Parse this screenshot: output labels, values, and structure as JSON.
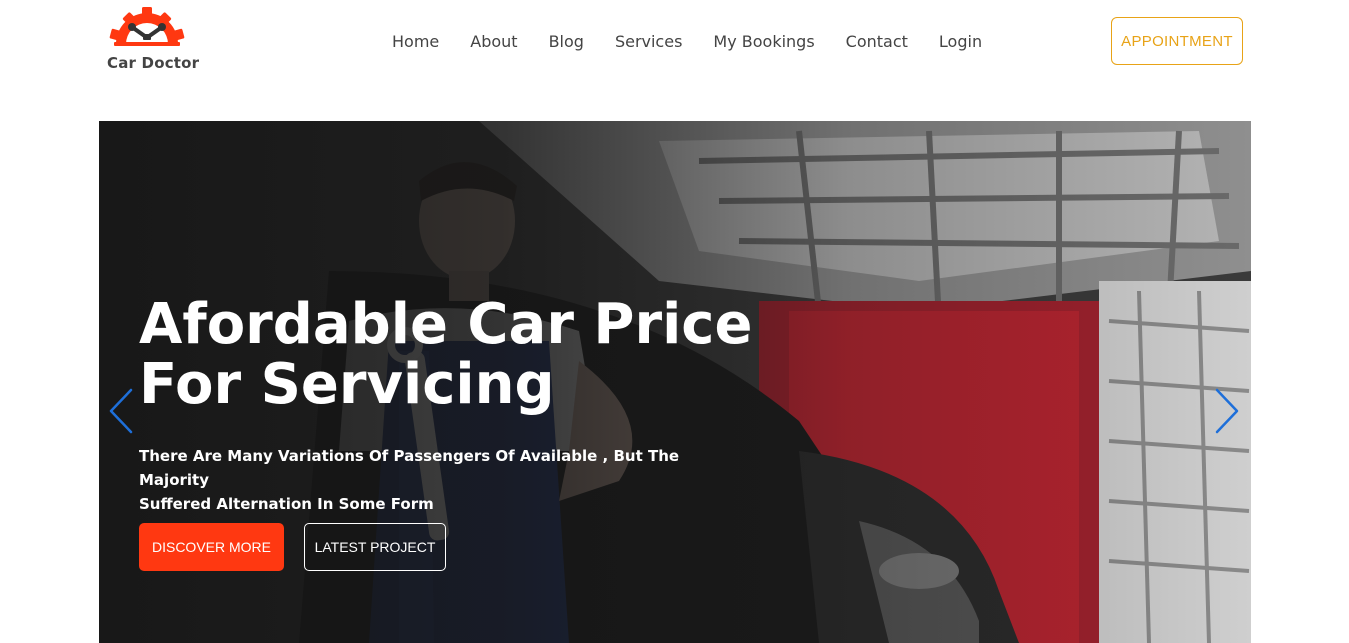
{
  "brand": {
    "name": "Car Doctor",
    "logo_icon": "gear-wrench-icon",
    "logo_color": "#ff3811"
  },
  "nav": {
    "items": [
      {
        "label": "Home"
      },
      {
        "label": "About"
      },
      {
        "label": "Blog"
      },
      {
        "label": "Services"
      },
      {
        "label": "My Bookings"
      },
      {
        "label": "Contact"
      },
      {
        "label": "Login"
      }
    ]
  },
  "header": {
    "appointment_label": "APPOINTMENT",
    "appointment_color": "#e8a317"
  },
  "hero": {
    "title_line1": "Afordable Car Price",
    "title_line2": "For Servicing",
    "subtitle_line1": "There Are Many Variations Of Passengers Of Available , But The Majority",
    "subtitle_line2": "Suffered Alternation In Some Form",
    "primary_button": "DISCOVER MORE",
    "secondary_button": "LATEST PROJECT",
    "primary_color": "#ff3811",
    "prev_icon": "chevron-left-icon",
    "next_icon": "chevron-right-icon",
    "arrow_color": "#1e6fd9"
  }
}
